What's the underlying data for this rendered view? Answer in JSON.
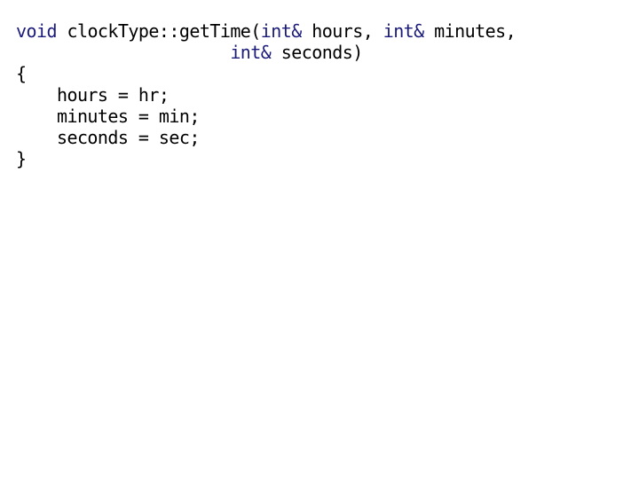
{
  "slide": {
    "background_color": "#ffffff",
    "text_color": "#000000",
    "keyword_color": "#1a1a7a",
    "language": "C++"
  },
  "code": {
    "full_text": "void clockType::getTime(int& hours, int& minutes,\n                     int& seconds)\n{\n    hours = hr;\n    minutes = min;\n    seconds = sec;\n}",
    "lines": [
      {
        "index": 1,
        "tokens": [
          {
            "text": "void",
            "kind": "keyword"
          },
          {
            "text": " clockType::getTime(",
            "kind": "plain"
          },
          {
            "text": "int&",
            "kind": "keyword"
          },
          {
            "text": " hours, ",
            "kind": "plain"
          },
          {
            "text": "int&",
            "kind": "keyword"
          },
          {
            "text": " minutes,",
            "kind": "plain"
          }
        ]
      },
      {
        "index": 2,
        "tokens": [
          {
            "text": "                     ",
            "kind": "plain"
          },
          {
            "text": "int&",
            "kind": "keyword"
          },
          {
            "text": " seconds)",
            "kind": "plain"
          }
        ]
      },
      {
        "index": 3,
        "tokens": [
          {
            "text": "{",
            "kind": "plain"
          }
        ]
      },
      {
        "index": 4,
        "tokens": [
          {
            "text": "    hours = hr;",
            "kind": "plain"
          }
        ]
      },
      {
        "index": 5,
        "tokens": [
          {
            "text": "    minutes = min;",
            "kind": "plain"
          }
        ]
      },
      {
        "index": 6,
        "tokens": [
          {
            "text": "    seconds = sec;",
            "kind": "plain"
          }
        ]
      },
      {
        "index": 7,
        "tokens": [
          {
            "text": "}",
            "kind": "plain"
          }
        ]
      }
    ]
  }
}
